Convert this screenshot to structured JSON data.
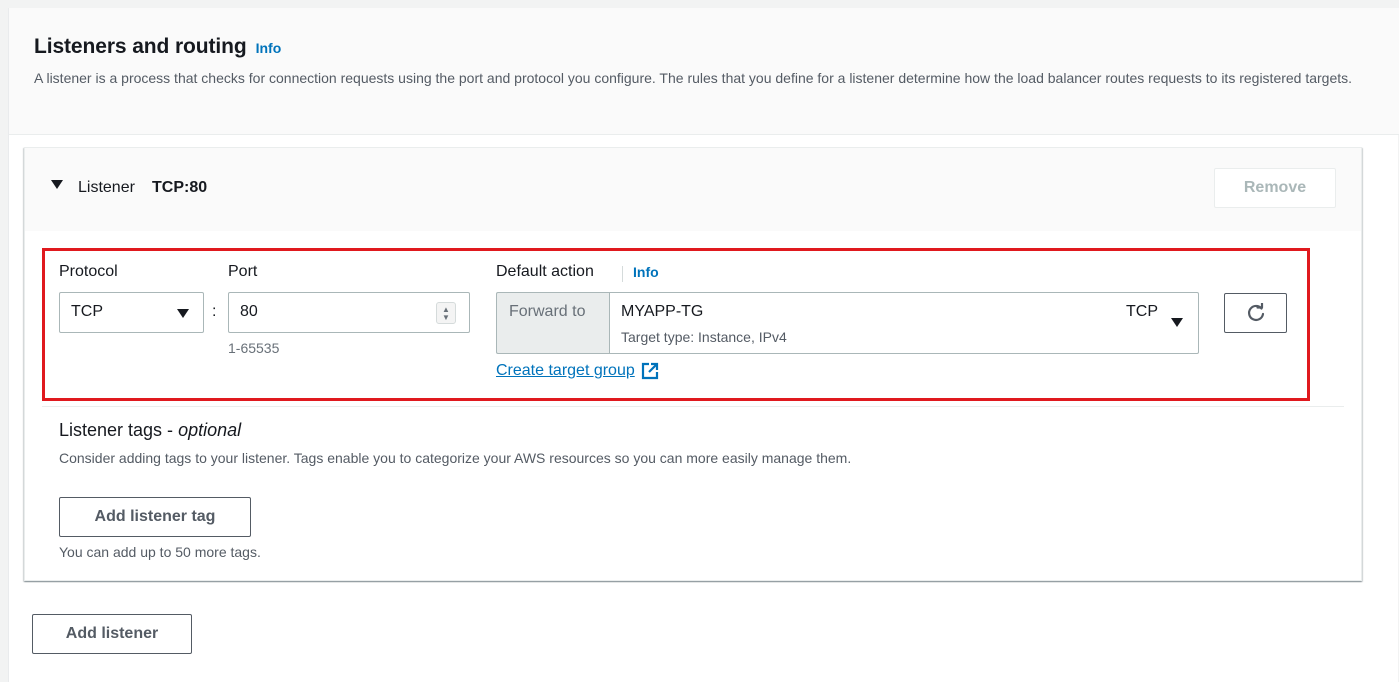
{
  "section": {
    "title": "Listeners and routing",
    "info": "Info",
    "description": "A listener is a process that checks for connection requests using the port and protocol you configure. The rules that you define for a listener determine how the load balancer routes requests to its registered targets."
  },
  "listener": {
    "label": "Listener",
    "name": "TCP:80",
    "remove_label": "Remove",
    "protocol_label": "Protocol",
    "protocol_value": "TCP",
    "port_label": "Port",
    "port_value": "80",
    "port_hint": "1-65535",
    "colon": ":",
    "default_action_label": "Default action",
    "default_action_info": "Info",
    "forward_to": "Forward to",
    "target_group_name": "MYAPP-TG",
    "target_group_type": "Target type: Instance, IPv4",
    "target_group_protocol": "TCP",
    "create_target_group": "Create target group"
  },
  "tags": {
    "title": "Listener tags - ",
    "title_optional": "optional",
    "description": "Consider adding tags to your listener. Tags enable you to categorize your AWS resources so you can more easily manage them.",
    "add_tag_label": "Add listener tag",
    "limit_hint": "You can add up to 50 more tags."
  },
  "add_listener_label": "Add listener",
  "colors": {
    "link": "#0073bb",
    "highlight": "#e0191e",
    "disabled_text": "#aab7b8"
  },
  "icons": [
    "caret-down-icon",
    "dropdown-arrow-icon",
    "spinner-icon",
    "refresh-icon",
    "external-link-icon"
  ]
}
